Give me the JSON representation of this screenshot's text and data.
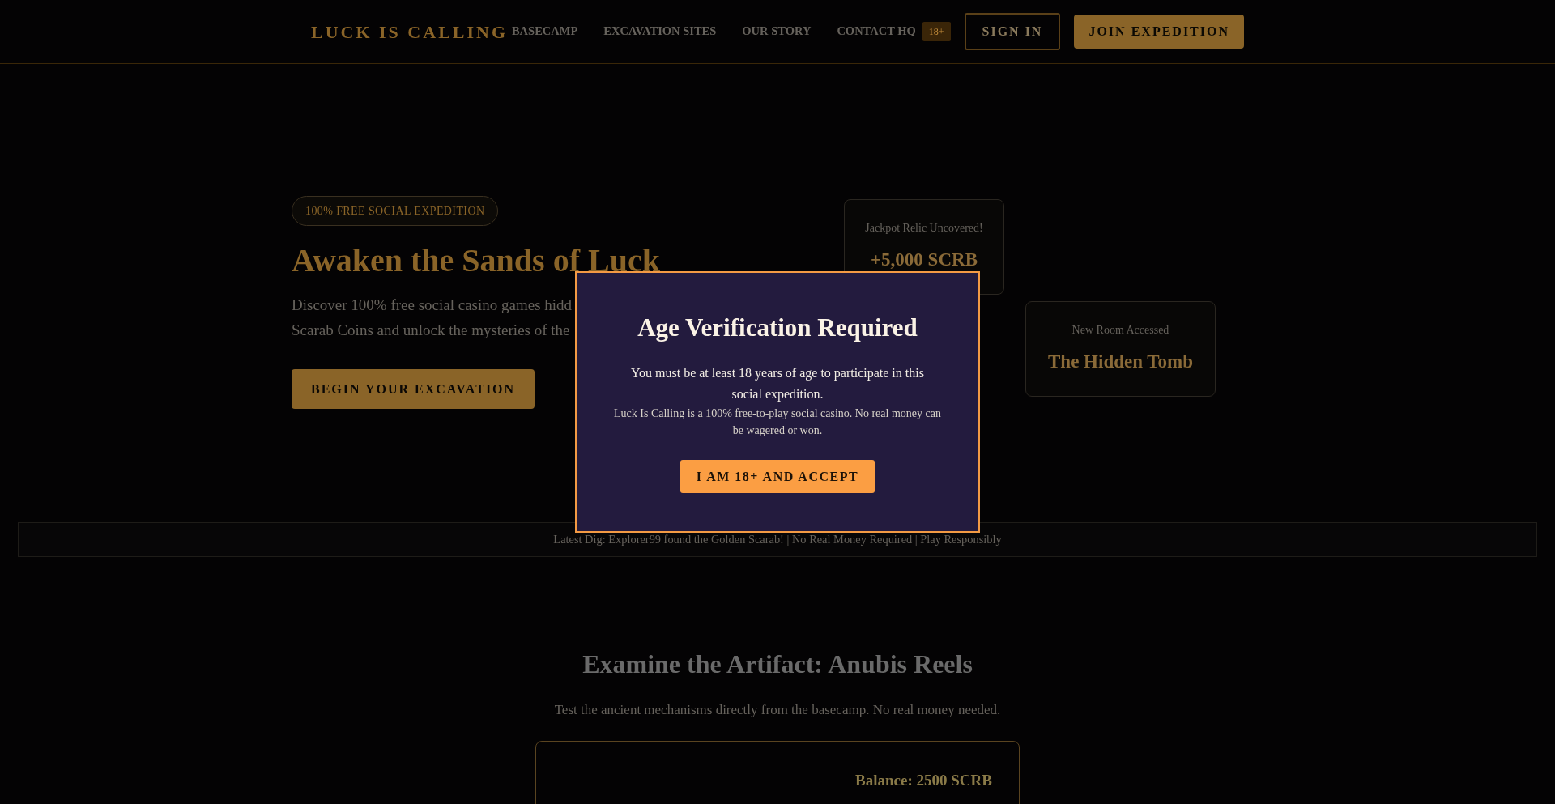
{
  "header": {
    "logo": "LUCK IS CALLING",
    "nav": [
      "BASECAMP",
      "EXCAVATION SITES",
      "OUR STORY",
      "CONTACT HQ"
    ],
    "age_badge": "18+",
    "sign_in": "SIGN IN",
    "join": "JOIN EXPEDITION"
  },
  "hero": {
    "badge": "100% FREE SOCIAL EXPEDITION",
    "title": "Awaken the Sands of Luck",
    "description_lines": [
      "Discover 100% free social casino games hidd",
      "Scarab Coins and unlock the mysteries of the"
    ],
    "cta": "BEGIN YOUR EXCAVATION",
    "cards": [
      {
        "label": "Jackpot Relic Uncovered!",
        "value": "+5,000 SCRB"
      },
      {
        "label": "New Room Accessed",
        "value": "The Hidden Tomb"
      }
    ]
  },
  "ticker": "Latest Dig: Explorer99 found the Golden Scarab! | No Real Money Required | Play Responsibly",
  "artifact_section": {
    "title": "Examine the Artifact: Anubis Reels",
    "subtitle": "Test the ancient mechanisms directly from the basecamp. No real money needed.",
    "balance": "Balance: 2500 SCRB"
  },
  "age_modal": {
    "title": "Age Verification Required",
    "message": "You must be at least 18 years of age to participate in this social expedition.",
    "disclaimer": "Luck Is Calling is a 100% free-to-play social casino. No real money can be wagered or won.",
    "accept": "I AM 18+ AND ACCEPT"
  }
}
